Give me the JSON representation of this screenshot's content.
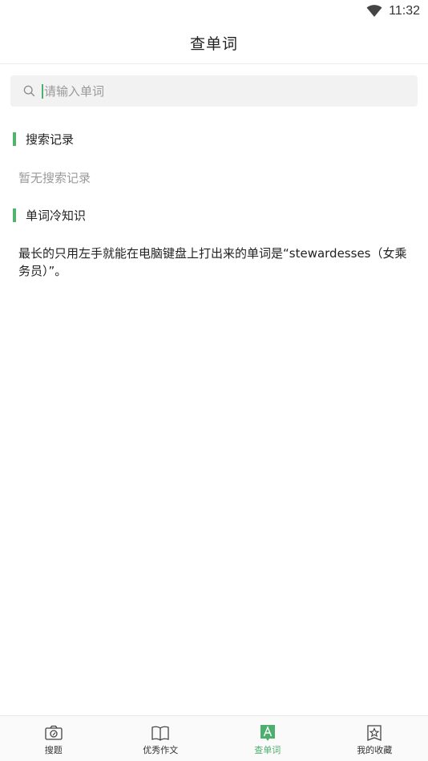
{
  "status_bar": {
    "time": "11:32"
  },
  "header": {
    "title": "查单词"
  },
  "search": {
    "placeholder": "请输入单词",
    "value": ""
  },
  "history": {
    "title": "搜索记录",
    "empty_text": "暂无搜索记录"
  },
  "trivia": {
    "title": "单词冷知识",
    "text": "最长的只用左手就能在电脑键盘上打出来的单词是“stewardesses（女乘务员）”。"
  },
  "bottom_nav": {
    "items": [
      {
        "label": "搜题",
        "icon": "camera-icon"
      },
      {
        "label": "优秀作文",
        "icon": "book-icon"
      },
      {
        "label": "查单词",
        "icon": "letter-a-icon",
        "active": true
      },
      {
        "label": "我的收藏",
        "icon": "star-bookmark-icon"
      }
    ]
  },
  "colors": {
    "accent": "#4caf6e",
    "section_bar": "#52b46c"
  }
}
